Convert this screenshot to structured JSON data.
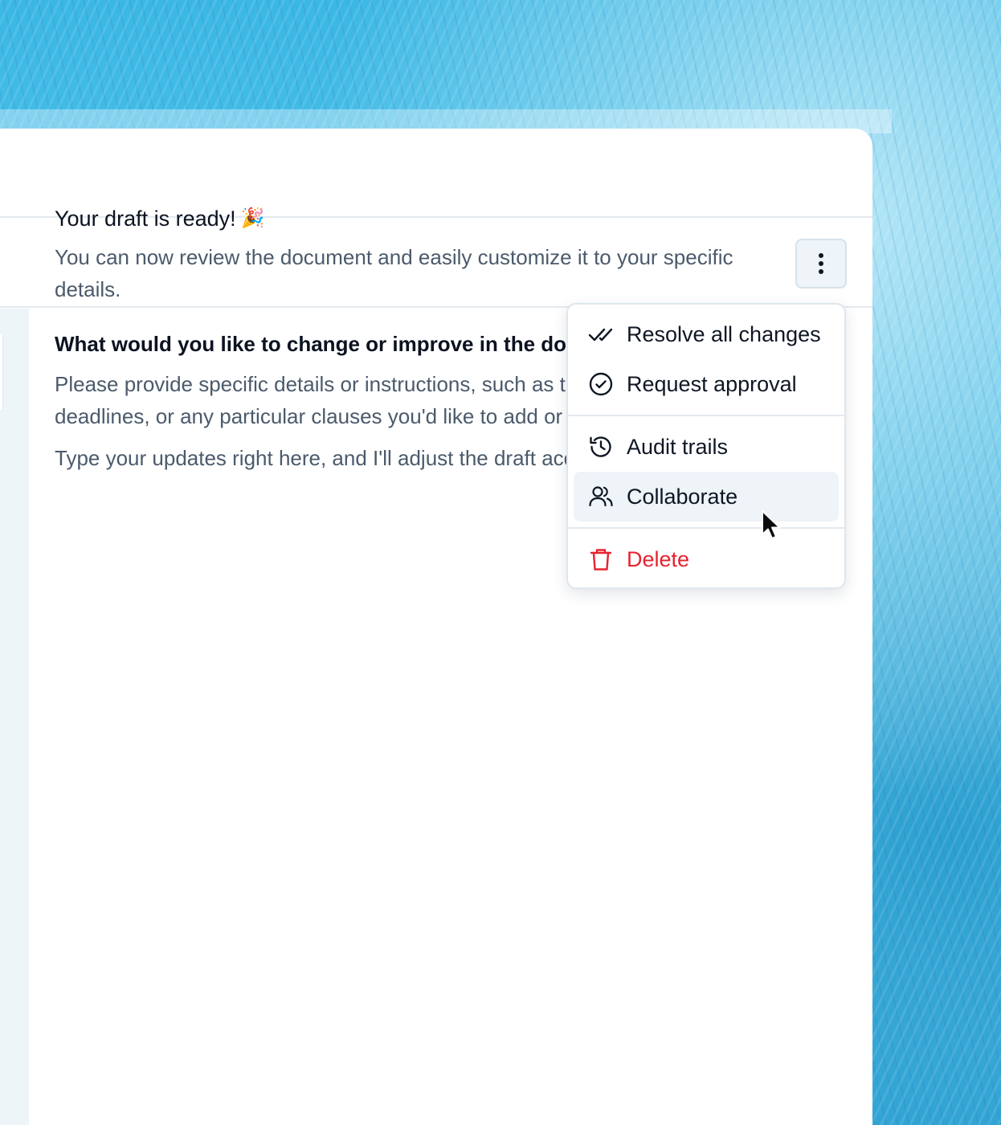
{
  "toolbar": {
    "more_button_icon": "more-vertical-icon"
  },
  "chat": {
    "heading": "Your draft is ready!",
    "heading_emoji": "🎉",
    "intro": "You can now review the document and easily customize it to your specific details.",
    "question": "What would you like to change or improve in the document?",
    "instructions": "Please provide specific details or instructions, such as tone adjustments, deadlines, or any particular clauses you'd like to add or modify.",
    "closing": "Type your updates right here, and I'll adjust the draft accordingly."
  },
  "menu": {
    "items": [
      {
        "label": "Resolve all changes",
        "icon": "double-check-icon"
      },
      {
        "label": "Request approval",
        "icon": "check-circle-icon"
      },
      {
        "label": "Audit trails",
        "icon": "history-icon"
      },
      {
        "label": "Collaborate",
        "icon": "users-icon"
      },
      {
        "label": "Delete",
        "icon": "trash-icon"
      }
    ],
    "active_item": "Collaborate"
  },
  "colors": {
    "danger": "#e5232f",
    "active_bg": "#eef4f8",
    "body_text": "#4b5a6b",
    "heading_text": "#0b1220"
  }
}
